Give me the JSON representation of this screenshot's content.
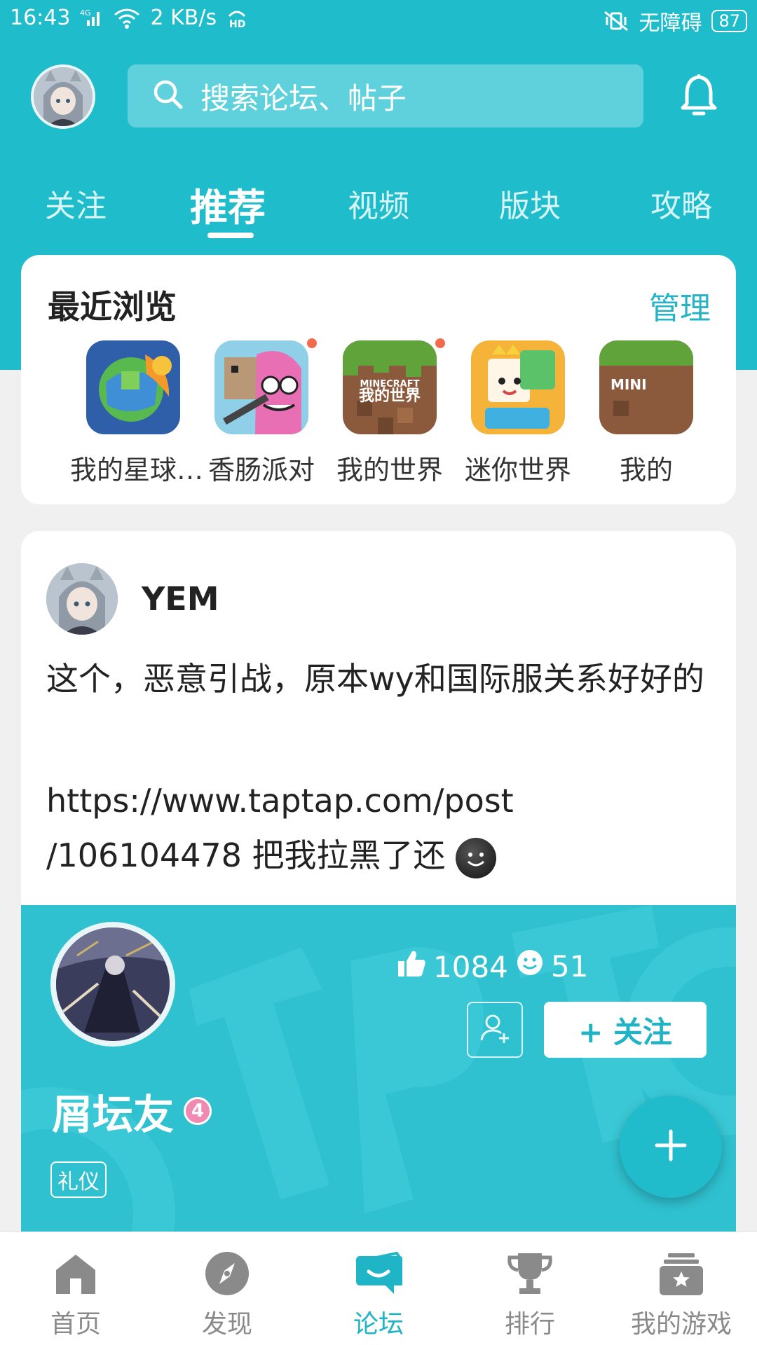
{
  "statusbar": {
    "time": "16:43",
    "network": "4G",
    "speed": "2 KB/s",
    "hd": "HD",
    "accessibility": "无障碍",
    "battery": "87"
  },
  "search": {
    "placeholder": "搜索论坛、帖子"
  },
  "tabs": [
    {
      "label": "关注"
    },
    {
      "label": "推荐",
      "active": true
    },
    {
      "label": "视频"
    },
    {
      "label": "版块"
    },
    {
      "label": "攻略"
    }
  ],
  "recent": {
    "title": "最近浏览",
    "manage": "管理",
    "games": [
      {
        "name": "我的星球…",
        "new": false
      },
      {
        "name": "香肠派对",
        "new": true
      },
      {
        "name": "我的世界",
        "new": true
      },
      {
        "name": "迷你世界",
        "new": false
      },
      {
        "name": "我的",
        "new": false
      }
    ]
  },
  "post": {
    "author": "YEM",
    "text": "这个，恶意引战，原本wy和国际服关系好好的",
    "link_line1": "https://www.taptap.com/post",
    "link_line2": "/106104478 把我拉黑了还"
  },
  "profile": {
    "likes": "1084",
    "smiles": "51",
    "follow_label": "+ 关注",
    "name": "屑坛友",
    "level": "4",
    "tag": "礼仪"
  },
  "bottomnav": [
    {
      "label": "首页"
    },
    {
      "label": "发现"
    },
    {
      "label": "论坛",
      "active": true
    },
    {
      "label": "排行"
    },
    {
      "label": "我的游戏"
    }
  ],
  "colors": {
    "accent": "#1fbccc",
    "dot": "#f26b4b"
  }
}
